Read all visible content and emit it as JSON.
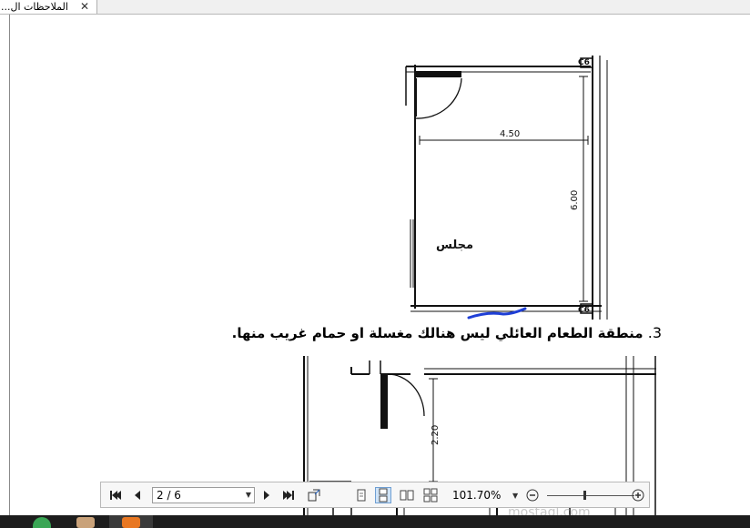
{
  "tab": {
    "title": "...الملاحظات ال",
    "close_glyph": "✕"
  },
  "document": {
    "plan1": {
      "width_dim": "4.50",
      "height_dim": "6.00",
      "room_label": "مجلس",
      "column_tag_top": "C6",
      "column_tag_bottom": "C6"
    },
    "caption": {
      "number": "3.",
      "text": "منطقة الطعام العائلي ليس هنالك مغسلة او حمام غريب منها."
    },
    "plan2": {
      "dim": "2.20"
    },
    "watermark": "mostaql.com"
  },
  "toolbar": {
    "page_indicator": "2 / 6",
    "zoom": "101.70%",
    "icons": [
      "first-page-icon",
      "previous-page-icon",
      "next-page-icon",
      "last-page-icon",
      "fit-page-icon",
      "single-page-icon",
      "continuous-page-icon",
      "two-page-icon",
      "two-page-continuous-icon",
      "zoom-out-icon",
      "zoom-in-icon"
    ]
  },
  "colors": {
    "annotation": "#1f3fd6",
    "taskbar": "#1d1d1d",
    "active_task": "#e87722"
  }
}
